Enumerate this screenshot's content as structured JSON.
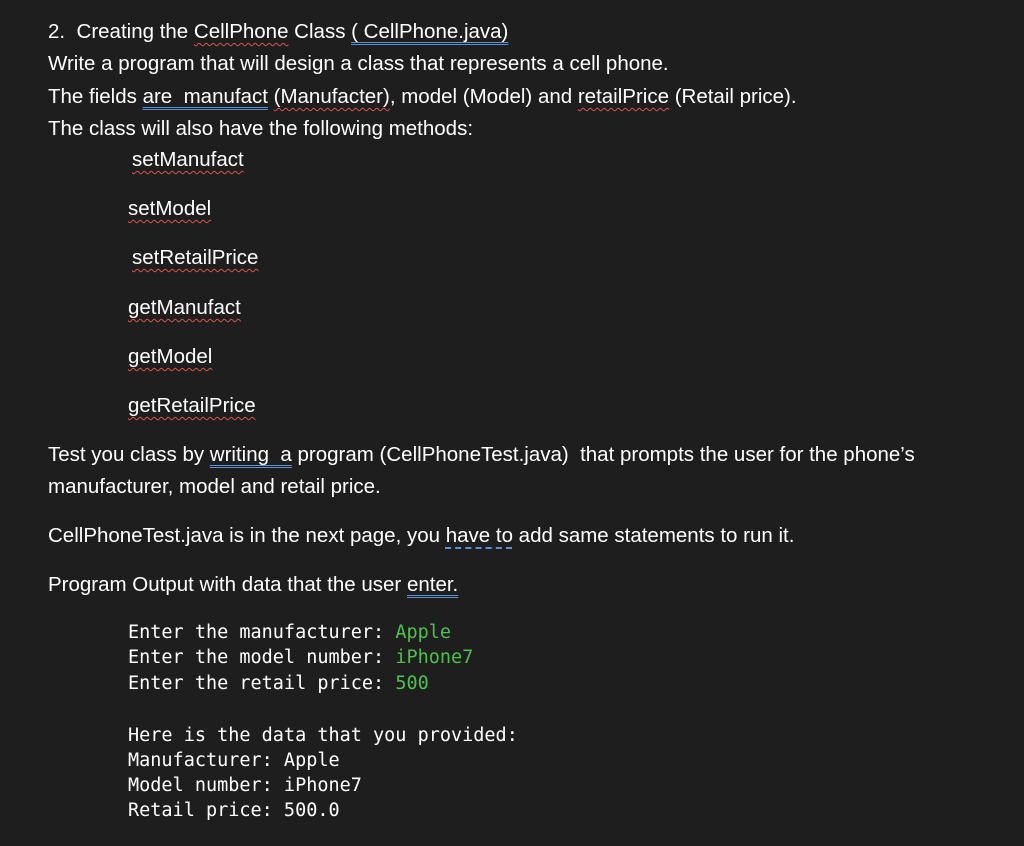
{
  "heading": {
    "number": "2.",
    "text_before": "Creating the ",
    "class_word": "CellPhone",
    "text_mid": " Class ",
    "file_ref": "( CellPhone.java)"
  },
  "intro": {
    "line1": "Write a program that will design a class that represents a cell phone.",
    "line2_a": "The fields ",
    "line2_b": "are  manufact",
    "line2_c": " ",
    "line2_d": "(Manufacter)",
    "line2_e": ", model (Model) and ",
    "line2_f": "retailPrice",
    "line2_g": " (Retail price).",
    "line3": "The class will also have the following methods:"
  },
  "methods": [
    "setManufact",
    "setModel",
    "setRetailPrice",
    "getManufact",
    "getModel",
    "getRetailPrice"
  ],
  "test": {
    "line1_a": "Test you class by ",
    "line1_b": "writing  a",
    "line1_c": " program (CellPhoneTest.java)  that prompts the user for the phone’s",
    "line2": "manufacturer, model and retail price.",
    "next_a": "CellPhoneTest.java is in the next page, you ",
    "next_b": "have to",
    "next_c": " add same statements to run it.",
    "output_a": "Program Output with data that the user ",
    "output_b": "enter."
  },
  "sample_output": {
    "prompts": [
      {
        "label": "Enter the manufacturer: ",
        "input": "Apple"
      },
      {
        "label": "Enter the model number: ",
        "input": "iPhone7"
      },
      {
        "label": "Enter the retail price: ",
        "input": "500"
      }
    ],
    "results": [
      "Here is the data that you provided:",
      "Manufacturer: Apple",
      "Model number: iPhone7",
      "Retail price: 500.0"
    ]
  },
  "colors": {
    "background": "#1e1e1e",
    "text": "#ffffff",
    "user_input": "#4ec04e",
    "spell_underline": "#d9534f",
    "grammar_underline": "#5b8fd6"
  }
}
